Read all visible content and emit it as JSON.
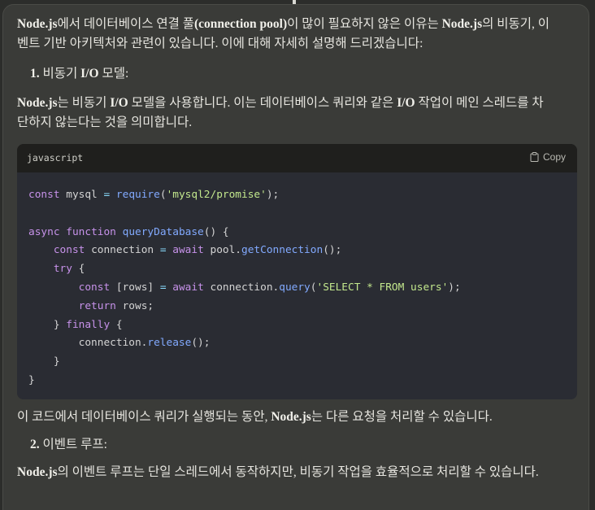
{
  "message": {
    "p1_b1": "Node.js",
    "p1_t1": "에서 데이터베이스 연결 풀",
    "p1_b2": "(connection pool)",
    "p1_t2": "이 많이 필요하지 않은 이유는 ",
    "p1_b3": "Node.js",
    "p1_t3": "의 비동기, 이벤트 기반 아키텍처와 관련이 있습니다. 이에 대해 자세히 설명해 드리겠습니다:",
    "h1_num": "1.",
    "h1_t1": "비동기 ",
    "h1_b": "I/O",
    "h1_t2": " 모델:",
    "p2_b1": "Node.js",
    "p2_t1": "는 비동기 ",
    "p2_b2": "I/O",
    "p2_t2": " 모델을 사용합니다. 이는 데이터베이스 쿼리와 같은 ",
    "p2_b3": "I/O",
    "p2_t3": " 작업이 메인 스레드를 차단하지 않는다는 것을 의미합니다.",
    "p3_t1": "이 코드에서 데이터베이스 쿼리가 실행되는 동안, ",
    "p3_b1": "Node.js",
    "p3_t2": "는 다른 요청을 처리할 수 있습니다.",
    "h2_num": "2.",
    "h2_t1": "이벤트 루프:",
    "p4_b1": "Node.js",
    "p4_t1": "의 이벤트 루프는 단일 스레드에서 동작하지만, 비동기 작업을 효율적으로 처리할 수 있습니다."
  },
  "code_block": {
    "language": "javascript",
    "copy_label": "Copy",
    "copy_icon": "clipboard-icon",
    "lines": [
      [
        [
          "kw",
          "const"
        ],
        [
          "plain",
          " mysql "
        ],
        [
          "op",
          "="
        ],
        [
          "plain",
          " "
        ],
        [
          "fn",
          "require"
        ],
        [
          "plain",
          "("
        ],
        [
          "str",
          "'mysql2/promise'"
        ],
        [
          "plain",
          ");"
        ]
      ],
      [],
      [
        [
          "kw",
          "async"
        ],
        [
          "plain",
          " "
        ],
        [
          "kw",
          "function"
        ],
        [
          "plain",
          " "
        ],
        [
          "fn",
          "queryDatabase"
        ],
        [
          "plain",
          "() {"
        ]
      ],
      [
        [
          "plain",
          "    "
        ],
        [
          "kw",
          "const"
        ],
        [
          "plain",
          " connection "
        ],
        [
          "op",
          "="
        ],
        [
          "plain",
          " "
        ],
        [
          "kw",
          "await"
        ],
        [
          "plain",
          " pool."
        ],
        [
          "fn",
          "getConnection"
        ],
        [
          "plain",
          "();"
        ]
      ],
      [
        [
          "plain",
          "    "
        ],
        [
          "kw",
          "try"
        ],
        [
          "plain",
          " {"
        ]
      ],
      [
        [
          "plain",
          "        "
        ],
        [
          "kw",
          "const"
        ],
        [
          "plain",
          " [rows] "
        ],
        [
          "op",
          "="
        ],
        [
          "plain",
          " "
        ],
        [
          "kw",
          "await"
        ],
        [
          "plain",
          " connection."
        ],
        [
          "fn",
          "query"
        ],
        [
          "plain",
          "("
        ],
        [
          "str",
          "'SELECT * FROM users'"
        ],
        [
          "plain",
          ");"
        ]
      ],
      [
        [
          "plain",
          "        "
        ],
        [
          "kw",
          "return"
        ],
        [
          "plain",
          " rows;"
        ]
      ],
      [
        [
          "plain",
          "    } "
        ],
        [
          "kw",
          "finally"
        ],
        [
          "plain",
          " {"
        ]
      ],
      [
        [
          "plain",
          "        connection."
        ],
        [
          "fn",
          "release"
        ],
        [
          "plain",
          "();"
        ]
      ],
      [
        [
          "plain",
          "    }"
        ]
      ],
      [
        [
          "plain",
          "}"
        ]
      ]
    ]
  },
  "colors": {
    "page_bg": "#2c2d2b",
    "card_bg": "#3a3b38",
    "text": "#e6e5df",
    "code_header_bg": "#1f1f1d",
    "code_body_bg": "#2a2c33",
    "keyword": "#c792ea",
    "function": "#82aaff",
    "string": "#c3e88d",
    "operator": "#89ddff"
  }
}
